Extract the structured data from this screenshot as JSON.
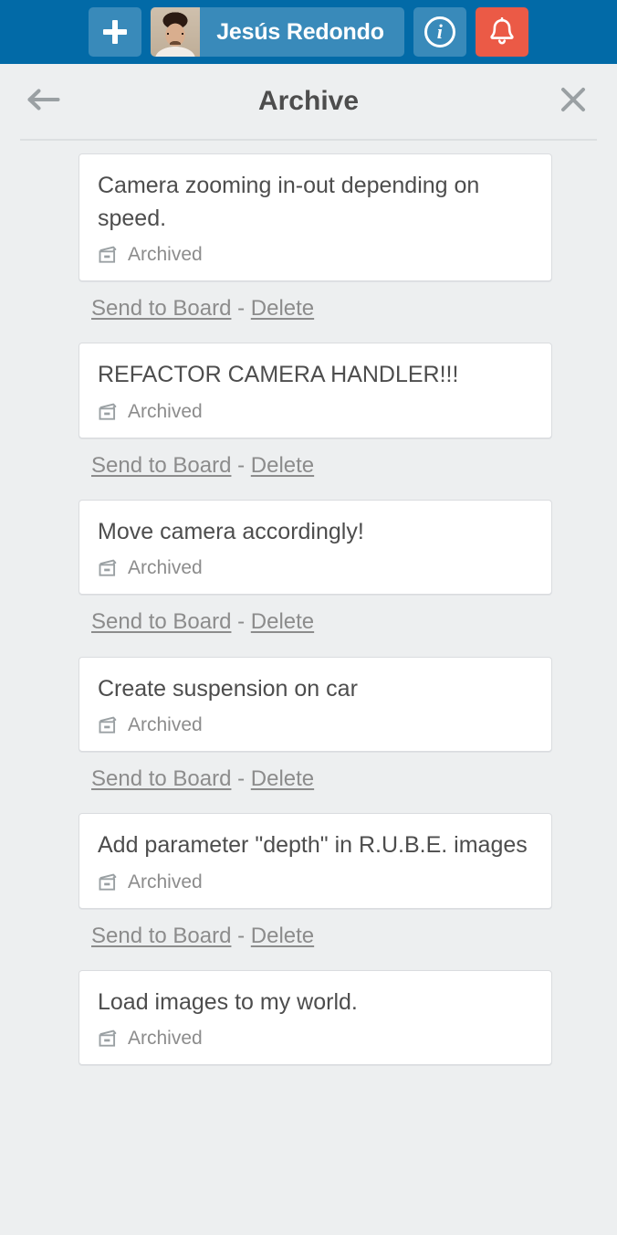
{
  "topbar": {
    "add_button": "add-button",
    "member_name": "Jesús Redondo",
    "info_button": "i",
    "notifications_button": "bell"
  },
  "panel": {
    "title": "Archive",
    "back_label": "Back",
    "close_label": "Close"
  },
  "archive": {
    "meta_label": "Archived",
    "send_to_board_label": "Send to Board",
    "separator": " - ",
    "delete_label": "Delete",
    "cards": [
      {
        "title": "Camera zooming in-out depending on speed.",
        "status": "Archived"
      },
      {
        "title": "REFACTOR CAMERA HANDLER!!!",
        "status": "Archived"
      },
      {
        "title": "Move camera accordingly!",
        "status": "Archived"
      },
      {
        "title": "Create suspension on car",
        "status": "Archived"
      },
      {
        "title": "Add parameter \"depth\" in R.U.B.E. images",
        "status": "Archived"
      },
      {
        "title": "Load images to my world.",
        "status": "Archived"
      }
    ]
  },
  "colors": {
    "topbar_blue": "#026aa7",
    "alert_red": "#eb5a46",
    "page_background": "#edeff0",
    "card_background": "#ffffff",
    "card_border": "#dadcdf",
    "text_primary": "#4d4d4d",
    "text_muted": "#8c8c8c"
  },
  "icons": {
    "add": "plus-icon",
    "info": "info-icon",
    "notifications": "bell-icon",
    "back": "back-arrow-icon",
    "close": "close-icon",
    "archive": "archive-box-icon"
  }
}
